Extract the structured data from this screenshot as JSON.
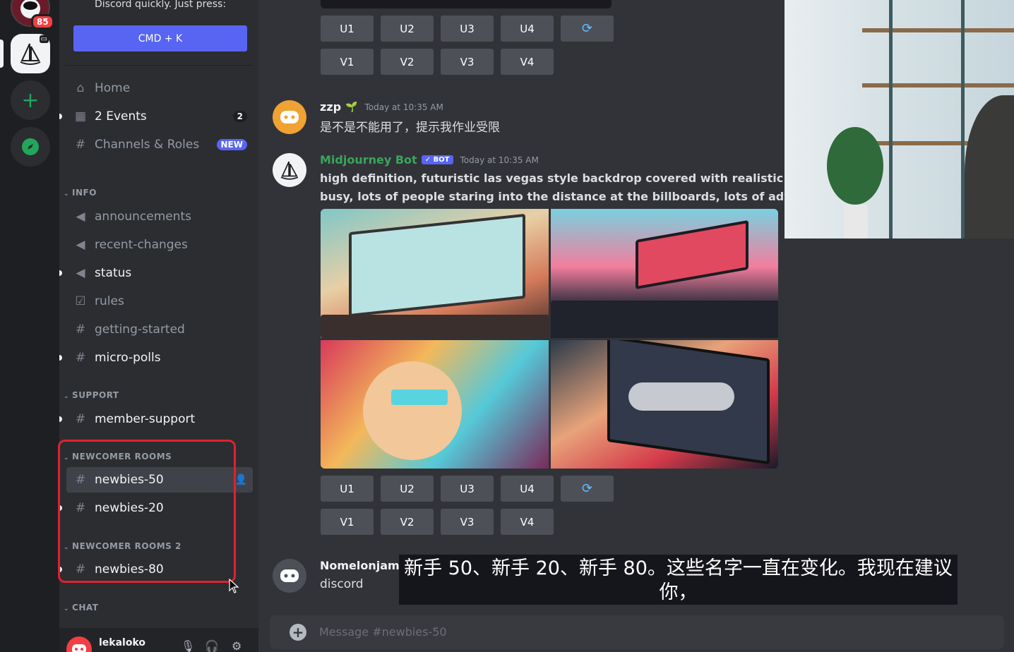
{
  "rail": {
    "badge_count": "85"
  },
  "sidebar": {
    "promo_text": "Discord quickly. Just press:",
    "shortcut_button": "CMD + K",
    "nav": [
      {
        "label": "Home",
        "icon": "home-icon"
      },
      {
        "label": "2 Events",
        "icon": "calendar-icon",
        "count": "2"
      },
      {
        "label": "Channels & Roles",
        "icon": "channels-roles-icon",
        "badge": "NEW"
      }
    ],
    "categories": {
      "info": "INFO",
      "support": "SUPPORT",
      "newcomer_rooms": "NEWCOMER ROOMS",
      "newcomer_rooms_2": "NEWCOMER ROOMS 2",
      "chat": "CHAT"
    },
    "channels": {
      "announcements": "announcements",
      "recent_changes": "recent-changes",
      "status": "status",
      "rules": "rules",
      "getting_started": "getting-started",
      "micro_polls": "micro-polls",
      "member_support": "member-support",
      "newbies_50": "newbies-50",
      "newbies_20": "newbies-20",
      "newbies_80": "newbies-80"
    },
    "user": {
      "name": "lekaloko"
    }
  },
  "chat": {
    "upscale_buttons": [
      "U1",
      "U2",
      "U3",
      "U4"
    ],
    "variation_buttons": [
      "V1",
      "V2",
      "V3",
      "V4"
    ],
    "messages": [
      {
        "author": "zzp",
        "timestamp": "Today at 10:35 AM",
        "text": "是不是不能用了，提示我作业受限"
      },
      {
        "author": "Midjourney Bot",
        "bot_badge": "✓ BOT",
        "timestamp": "Today at 10:35 AM",
        "text_line1": "high definition, futuristic las vegas style backdrop covered with realistic advert",
        "text_line2": "busy, lots of people staring into the distance at the billboards, lots of advertisin"
      },
      {
        "author": "Nomelonjam",
        "text": "discord"
      }
    ],
    "composer_placeholder": "Message #newbies-50"
  },
  "subtitle": {
    "line1": "新手 50、新手 20、新手 80。这些名字一直在变化。我现在建议",
    "line2": "你，"
  },
  "colors": {
    "accent": "#5865f2",
    "highlight_box": "#e0212f",
    "bot_name": "#3ba55c"
  }
}
